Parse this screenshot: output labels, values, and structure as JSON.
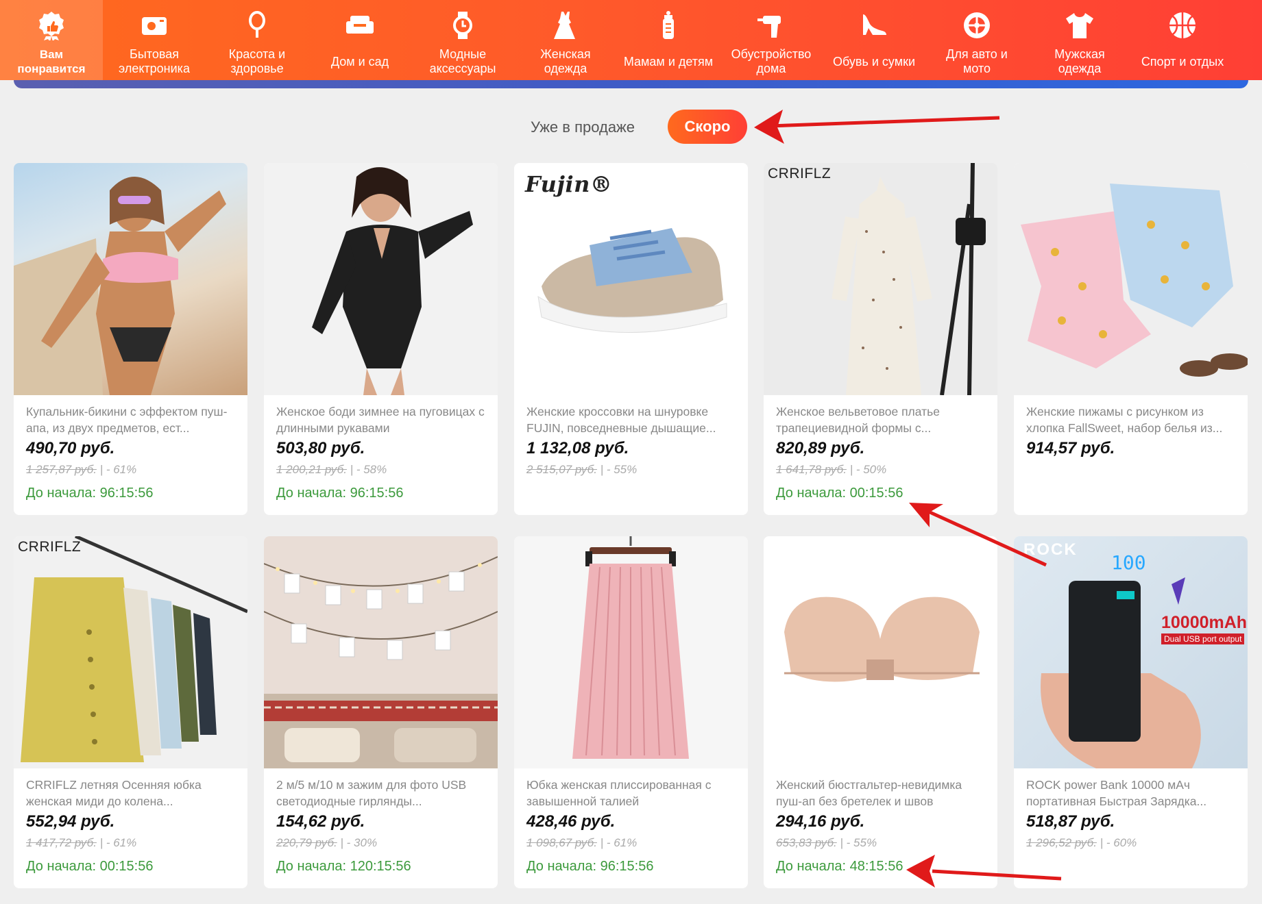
{
  "categories": [
    {
      "label": "Вам\nпонравится",
      "icon": "thumbs-up-badge-icon",
      "active": true
    },
    {
      "label": "Бытовая\nэлектроника",
      "icon": "camera-icon"
    },
    {
      "label": "Красота и\nздоровье",
      "icon": "mirror-icon"
    },
    {
      "label": "Дом и сад",
      "icon": "sofa-icon"
    },
    {
      "label": "Модные\nаксессуары",
      "icon": "watch-icon"
    },
    {
      "label": "Женская\nодежда",
      "icon": "dress-icon"
    },
    {
      "label": "Мамам и детям",
      "icon": "baby-bottle-icon"
    },
    {
      "label": "Обустройство\nдома",
      "icon": "drill-icon"
    },
    {
      "label": "Обувь и сумки",
      "icon": "high-heel-icon"
    },
    {
      "label": "Для авто и\nмото",
      "icon": "wheel-icon"
    },
    {
      "label": "Мужская\nодежда",
      "icon": "tshirt-icon"
    },
    {
      "label": "Спорт и отдых",
      "icon": "ball-icon"
    }
  ],
  "tabs": {
    "on_sale": "Уже в продаже",
    "soon": "Скоро"
  },
  "products": [
    {
      "title": "Купальник-бикини с эффектом пуш-апа, из двух предметов, ест...",
      "price": "490,70 руб.",
      "old_price": "1 257,87 руб.",
      "discount": "| - 61%",
      "timer": "До начала: 96:15:56"
    },
    {
      "title": "Женское боди зимнее на пуговицах с длинными рукавами",
      "price": "503,80 руб.",
      "old_price": "1 200,21 руб.",
      "discount": "| - 58%",
      "timer": "До начала: 96:15:56"
    },
    {
      "title": "Женские кроссовки на шнуровке FUJIN, повседневные дышащие...",
      "price": "1 132,08 руб.",
      "old_price": "2 515,07 руб.",
      "discount": "| - 55%",
      "timer": "",
      "brand": "Fujin®"
    },
    {
      "title": "Женское вельветовое платье трапециевидной формы с...",
      "price": "820,89 руб.",
      "old_price": "1 641,78 руб.",
      "discount": "| - 50%",
      "timer": "До начала: 00:15:56",
      "brand": "CRRIFLZ"
    },
    {
      "title": "Женские пижамы с рисунком из хлопка FallSweet, набор белья из...",
      "price": "914,57 руб.",
      "old_price": "",
      "discount": "",
      "timer": ""
    },
    {
      "title": "CRRIFLZ летняя Осенняя юбка женская миди до колена...",
      "price": "552,94 руб.",
      "old_price": "1 417,72 руб.",
      "discount": "| - 61%",
      "timer": "До начала: 00:15:56",
      "brand": "CRRIFLZ"
    },
    {
      "title": "2 м/5 м/10 м зажим для фото USB светодиодные гирлянды...",
      "price": "154,62 руб.",
      "old_price": "220,79 руб.",
      "discount": "| - 30%",
      "timer": "До начала: 120:15:56"
    },
    {
      "title": "Юбка женская плиссированная с завышенной талией",
      "price": "428,46 руб.",
      "old_price": "1 098,67 руб.",
      "discount": "| - 61%",
      "timer": "До начала: 96:15:56"
    },
    {
      "title": "Женский бюстгальтер-невидимка пуш-ап без бретелек и швов",
      "price": "294,16 руб.",
      "old_price": "653,83 руб.",
      "discount": "| - 55%",
      "timer": "До начала: 48:15:56"
    },
    {
      "title": "ROCK power Bank 10000 мАч портативная Быстрая Зарядка...",
      "price": "518,87 руб.",
      "old_price": "1 296,52 руб.",
      "discount": "| - 60%",
      "timer": "",
      "brand": "ROCK",
      "badge": "10000mAh",
      "badge_sub": "Dual USB port output",
      "display": "100"
    }
  ],
  "colors": {
    "accent": "#ff5a2a",
    "timer": "#3c9a3c",
    "arrow": "#e01a1a"
  }
}
